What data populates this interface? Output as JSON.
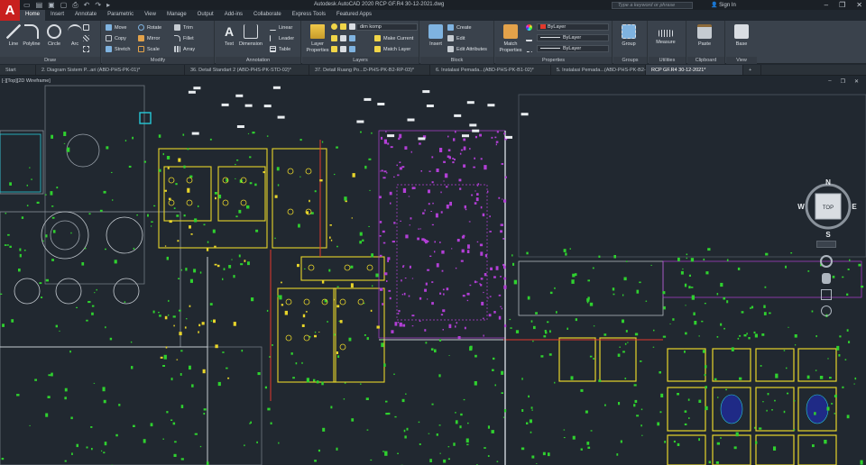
{
  "app": {
    "logo_letter": "A",
    "title": "Autodesk AutoCAD 2020    RCP GF.R4 30-12-2021.dwg",
    "search_placeholder": "Type a keyword or phrase",
    "signin_label": "Sign In",
    "qat_icons": [
      "new-icon",
      "open-icon",
      "save-icon",
      "saveas-icon",
      "plot-icon",
      "undo-icon",
      "redo-icon",
      "share-icon"
    ]
  },
  "ribbon_tabs": [
    "Home",
    "Insert",
    "Annotate",
    "Parametric",
    "View",
    "Manage",
    "Output",
    "Add-ins",
    "Collaborate",
    "Express Tools",
    "Featured Apps"
  ],
  "ribbon": {
    "draw": {
      "label": "Draw",
      "tools": [
        "Line",
        "Polyline",
        "Circle",
        "Arc"
      ]
    },
    "modify": {
      "label": "Modify",
      "tools": [
        "Move",
        "Rotate",
        "Trim",
        "Copy",
        "Mirror",
        "Fillet",
        "Stretch",
        "Scale",
        "Array"
      ]
    },
    "annotation": {
      "label": "Annotation",
      "text_tool": "Text",
      "dimension_tool": "Dimension",
      "linear": "Linear",
      "leader": "Leader",
      "table": "Table"
    },
    "layers": {
      "label": "Layers",
      "properties": "Layer Properties",
      "current_layer": "dim komp",
      "make_current": "Make Current",
      "match_layer": "Match Layer"
    },
    "block": {
      "label": "Block",
      "insert": "Insert",
      "create": "Create",
      "edit": "Edit",
      "edit_attributes": "Edit Attributes"
    },
    "properties": {
      "label": "Properties",
      "match": "Match Properties",
      "color": "ByLayer",
      "linetype": "ByLayer",
      "lineweight": "ByLayer"
    },
    "groups": {
      "label": "Groups",
      "group": "Group"
    },
    "utilities": {
      "label": "Utilities",
      "measure": "Measure"
    },
    "clipboard": {
      "label": "Clipboard",
      "paste": "Paste"
    },
    "view": {
      "label": "View",
      "base": "Base"
    }
  },
  "doc_tabs": [
    "Start",
    "2. Diagram Sistem P...ari (ABD-PHS-PK-01)*",
    "36. Detail Standart 2 (ABD-PHS-PK-STD-02)*",
    "37. Detail Ruang Po...D-PHS-PK-B2-RP-03)*",
    "6. Instalasi Pemada...(ABD-PHS-PK-B1-02)*",
    "5. Instalasi Pemada...(ABD-PHS-PK-B2-01)*",
    "RCP GF.R4 30-12-2021*",
    "+"
  ],
  "viewport": {
    "label": "[-][Top][2D Wireframe]",
    "viewcube": {
      "face": "TOP",
      "north": "N",
      "south": "S",
      "east": "E",
      "west": "W"
    }
  },
  "colors": {
    "background": "#212830",
    "ribbon": "#3a424c",
    "cad_green": "#2fd12f",
    "cad_yellow": "#e8d52a",
    "cad_magenta": "#b23fd6",
    "cad_red": "#e3392c",
    "cad_white": "#e9edf0",
    "cad_gray": "#8a929b",
    "cad_cyan": "#27c8d8"
  }
}
